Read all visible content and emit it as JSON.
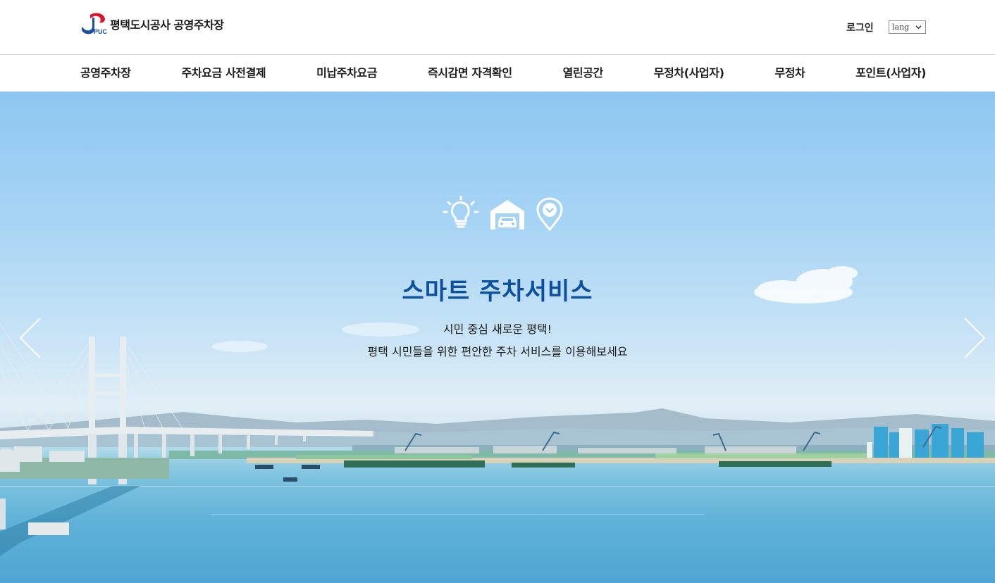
{
  "header": {
    "logo_mark_text": "PUC",
    "logo_text": "평택도시공사 공영주차장",
    "login_label": "로그인",
    "lang_selected": "lang"
  },
  "nav": {
    "items": [
      "공영주차장",
      "주차요금 사전결제",
      "미납주차요금",
      "즉시감면 자격확인",
      "열린공간",
      "무정차(사업자)",
      "무정차",
      "포인트(사업자)"
    ]
  },
  "hero": {
    "icons": [
      "lightbulb-icon",
      "garage-car-icon",
      "location-pin-icon"
    ],
    "title": "스마트 주차서비스",
    "subtitle_line1": "시민 중심 새로운 평택!",
    "subtitle_line2": "평택 시민들을 위한 편안한 주차 서비스를 이용해보세요",
    "prev_icon": "chevron-left-icon",
    "next_icon": "chevron-right-icon"
  },
  "colors": {
    "title_blue": "#0c4f9e",
    "logo_red": "#d7192f",
    "logo_blue": "#1c4fa0",
    "sky": "#8dc7f2",
    "sea": "#4fa6d2"
  }
}
